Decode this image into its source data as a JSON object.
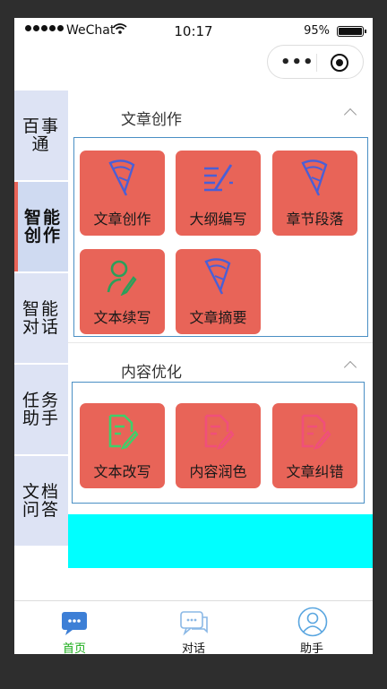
{
  "status_bar": {
    "carrier": "WeChat",
    "time": "10:17",
    "battery": "95%"
  },
  "capsule": {
    "more_icon": "more-dots-icon",
    "close_icon": "target-circle-icon"
  },
  "sidebar": {
    "items": [
      {
        "label": "百事通",
        "active": false
      },
      {
        "label": "智能创作",
        "active": true
      },
      {
        "label": "智能对话",
        "active": false
      },
      {
        "label": "任务助手",
        "active": false
      },
      {
        "label": "文档问答",
        "active": false
      }
    ]
  },
  "sections": [
    {
      "title": "文章创作",
      "tiles": [
        {
          "label": "文章创作",
          "icon": "pencil-cone-icon"
        },
        {
          "label": "大纲编写",
          "icon": "lines-pen-icon"
        },
        {
          "label": "章节段落",
          "icon": "pencil-cone-icon"
        },
        {
          "label": "文本续写",
          "icon": "user-pen-icon"
        },
        {
          "label": "文章摘要",
          "icon": "pencil-cone-icon"
        }
      ]
    },
    {
      "title": "内容优化",
      "tiles": [
        {
          "label": "文本改写",
          "icon": "doc-edit-icon"
        },
        {
          "label": "内容润色",
          "icon": "doc-edit-icon"
        },
        {
          "label": "文章纠错",
          "icon": "doc-edit-icon"
        }
      ]
    }
  ],
  "tabbar": {
    "items": [
      {
        "label": "首页",
        "icon": "chat-home-icon",
        "active": true
      },
      {
        "label": "对话",
        "icon": "chat-bubbles-icon",
        "active": false
      },
      {
        "label": "助手",
        "icon": "avatar-icon",
        "active": false
      }
    ]
  },
  "colors": {
    "tile_bg": "#e86458",
    "sidebar_bg": "#dde3f4",
    "active_marker": "#e86458",
    "tab_active": "#1aad19",
    "highlight": "#00ffff"
  }
}
